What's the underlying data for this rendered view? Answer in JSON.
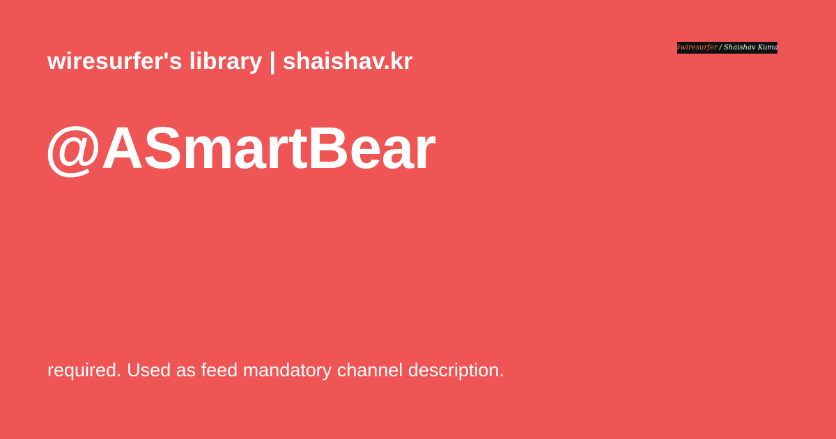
{
  "card": {
    "site_title": "wiresurfer's library | shaishav.kr",
    "page_title": "@ASmartBear",
    "description": "required. Used as feed mandatory channel description."
  },
  "signature": {
    "handle": "@wiresurfer",
    "separator": "/",
    "author": "Shaishav Kumar"
  },
  "colors": {
    "background": "#f05555",
    "text": "#ffffff",
    "signature_bg": "#111111",
    "signature_accent": "#f07a4a"
  }
}
